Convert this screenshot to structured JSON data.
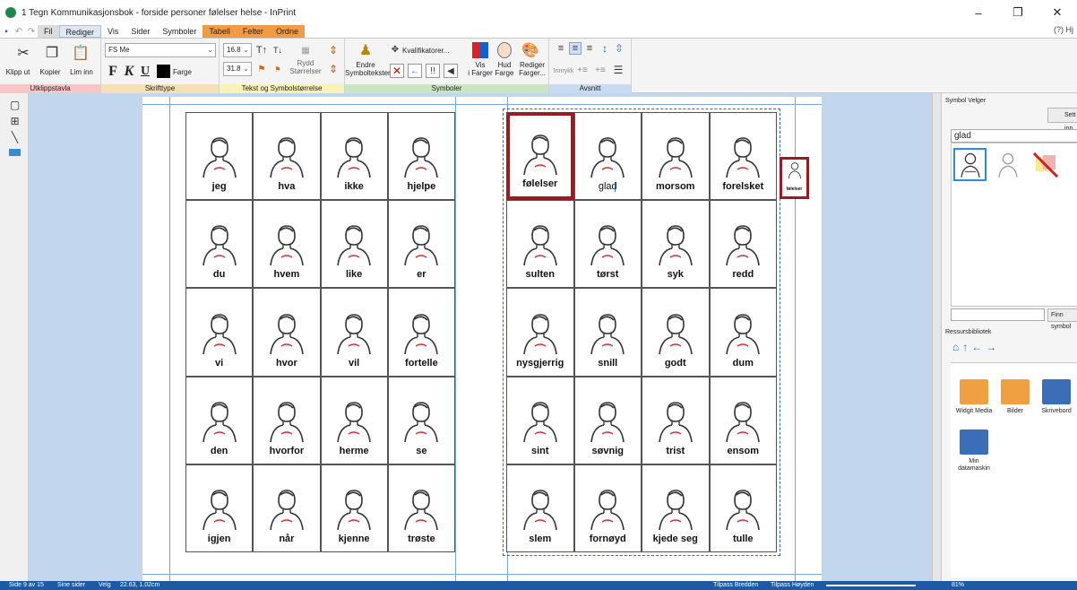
{
  "window": {
    "title": "1 Tegn Kommunikasjonsbok - forside personer følelser helse - InPrint",
    "controls": [
      "–",
      "❐",
      "✕"
    ]
  },
  "menu": {
    "tabs": [
      "Fil",
      "Rediger",
      "Vis",
      "Sider",
      "Symboler",
      "Tabell",
      "Felter",
      "Ordne"
    ],
    "active": "Rediger",
    "help": "(?) Hj"
  },
  "ribbon": {
    "clipboard": {
      "label": "Utklippstavla",
      "cut": "Klipp ut",
      "copy": "Kopier",
      "paste": "Lim inn"
    },
    "font": {
      "label": "Skrifttype",
      "family": "FS Me",
      "bold": "F",
      "italic": "K",
      "underline": "U",
      "color": "Farge"
    },
    "sizes": {
      "label": "Tekst og Symbolstørrelse",
      "text_size": "16.8",
      "symbol_size": "31.8",
      "tidy_line1": "Rydd",
      "tidy_line2": "Størrelser"
    },
    "symbols": {
      "label": "Symboler",
      "change_line1": "Endre",
      "change_line2": "Symbolteksten",
      "qualifiers": "Kvalifikatorer...",
      "show_line1": "Vis",
      "show_line2": "i Farger",
      "skin_line1": "Hud",
      "skin_line2": "Farge",
      "edit_line1": "Rediger",
      "edit_line2": "Farger..."
    },
    "paragraph": {
      "label": "Avsnitt",
      "indent": "Innrykk"
    }
  },
  "left_page": {
    "rows": [
      [
        "jeg",
        "hva",
        "ikke",
        "hjelpe"
      ],
      [
        "du",
        "hvem",
        "like",
        "er"
      ],
      [
        "vi",
        "hvor",
        "vil",
        "fortelle"
      ],
      [
        "den",
        "hvorfor",
        "herme",
        "se"
      ],
      [
        "igjen",
        "når",
        "kjenne",
        "trøste"
      ]
    ]
  },
  "right_page": {
    "rows": [
      [
        "følelser",
        "glad",
        "morsom",
        "forelsket"
      ],
      [
        "sulten",
        "tørst",
        "syk",
        "redd"
      ],
      [
        "nysgjerrig",
        "snill",
        "godt",
        "dum"
      ],
      [
        "sint",
        "søvnig",
        "trist",
        "ensom"
      ],
      [
        "slem",
        "fornøyd",
        "kjede seg",
        "tulle"
      ]
    ],
    "selected": "følelser",
    "editing": "glad"
  },
  "floating_symbol": {
    "label": "følelser"
  },
  "symbol_picker": {
    "title": "Symbol Velger",
    "insert_button": "Sett inn",
    "search_value": "glad",
    "find_button": "Finn symbol"
  },
  "resource_library": {
    "title": "Ressursbibliotek",
    "items": [
      {
        "label": "Widgit Media",
        "color": "#f0a040"
      },
      {
        "label": "Bilder",
        "color": "#f0a040"
      },
      {
        "label": "Skrivebord",
        "color": "#3a6fb8"
      },
      {
        "label": "Min datamaskin",
        "color": "#3a6fb8"
      }
    ]
  },
  "status": {
    "page": "Side 9 av 15",
    "pages_toggle": "Sine sider",
    "select": "Velg",
    "coords": "22.63, 1.02cm",
    "fit_width": "Tilpass Bredden",
    "fit_height": "Tilpass Høyden",
    "zoom": "81%"
  },
  "colors": {
    "selection": "#9a1b22",
    "canvas": "#c2d7ee",
    "status": "#1e5aa3",
    "contextual_tab": "#f29b47"
  }
}
